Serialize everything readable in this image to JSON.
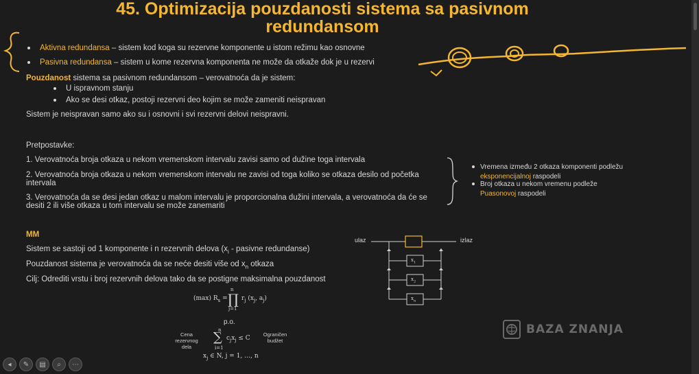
{
  "slide": {
    "title_line1": "45. Optimizacija pouzdanosti sistema sa pasivnom",
    "title_line2": "redundansom",
    "bullets_top": [
      {
        "term": "Aktivna redundansa",
        "rest": " – sistem kod koga su rezervne komponente u istom režimu kao osnovne"
      },
      {
        "term": "Pasivna redundansa",
        "rest": " – sistem u kome rezervna komponenta ne može da otkaže dok je u rezervi"
      }
    ],
    "reliability_term": "Pouzdanost",
    "reliability_rest": " sistema sa pasivnom redundansom – verovatnoća da je sistem:",
    "reliability_items": [
      "U ispravnom stanju",
      "Ako se desi otkaz, postoji rezervni deo kojim se može zameniti neispravan"
    ],
    "faulty_line": "Sistem je neispravan samo ako su i osnovni i svi rezervni delovi neispravni.",
    "assumptions_heading": "Pretpostavke:",
    "assumptions": [
      "1. Verovatnoća broja otkaza u nekom vremenskom intervalu zavisi samo od dužine toga intervala",
      "2. Verovatnoća broja otkaza u nekom vremenskom intervalu ne zavisi od toga koliko se otkaza desilo od početka",
      "intervala",
      "3. Verovatnoća da se desi jedan otkaz u malom intervalu je proporcionalna dužini intervala, a verovatnoća da će se",
      "desiti 2 ili više otkaza u tom intervalu se može zanemariti"
    ],
    "side_notes": {
      "n1_a": "Vremena između 2 otkaza komponenti podležu",
      "n1_b": "eksponencijalnoj",
      "n1_c": " raspodeli",
      "n2_a": "Broj otkaza u nekom vremenu podleže",
      "n2_b": "Puasonovoj",
      "n2_c": " raspodeli"
    },
    "mm_heading": "MM",
    "mm_lines": [
      "Sistem se sastoji od 1 komponente i n rezervnih delova (x",
      "Pouzdanost sistema je verovatnoća da se neće desiti više od x",
      "Cilj: Odrediti vrstu i broj rezervnih delova tako da se postigne maksimalna pouzdanost"
    ],
    "mm_line1_sub": "i",
    "mm_line1_tail": " - pasivne redundanse)",
    "mm_line2_sub": "n",
    "mm_line2_tail": " otkaza",
    "formula_max": "(max) R",
    "formula_sub": "s",
    "formula_eq": " = ",
    "formula_prod": "∏",
    "formula_top": "n",
    "formula_bottom": "j=1",
    "formula_body": "r",
    "formula_body_sub": "j",
    "formula_args": " (x",
    "formula_args_sub": "j",
    "formula_args2": ", a",
    "formula_args2_sub": "j",
    "formula_close": ")",
    "po": "p.o.",
    "cost_label": "Cena\nrezervnog\ndela",
    "budget_label": "Ograničen\nbudžet",
    "constraint_sum": "∑",
    "constraint_top": "n",
    "constraint_bottom": "i=1",
    "constraint_body": "c",
    "constraint_body_sub": "j",
    "constraint_x": "x",
    "constraint_x_sub": "j",
    "constraint_rel": " ≤ C",
    "domain_line": "x",
    "domain_sub": "j",
    "domain_rest": " ∈ N, j = 1, …, n",
    "diagram": {
      "in_label": "ulaz",
      "out_label": "izlaz",
      "box1": "x",
      "box1_sub": "1",
      "box2": "x",
      "box2_sub": "2",
      "box3": "x",
      "box3_sub": "n"
    },
    "logo_text": "BAZA ZNANJA"
  },
  "toolbar": [
    "prev-icon",
    "pen-icon",
    "slides-icon",
    "zoom-icon",
    "more-icon"
  ],
  "colors": {
    "accent": "#f5b731",
    "bg": "#1c1c1c",
    "text": "#d8d8d8"
  }
}
